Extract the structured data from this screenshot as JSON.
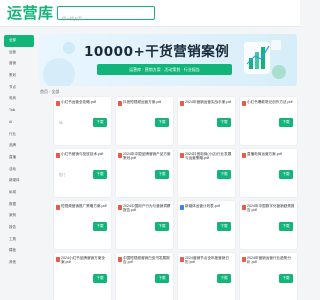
{
  "header": {
    "logo": "运营库",
    "search_placeholder": "搜一搜方案"
  },
  "sidebar": {
    "items": [
      {
        "label": "全部"
      },
      {
        "label": "运营"
      },
      {
        "label": "营销"
      },
      {
        "label": "策划"
      },
      {
        "label": "节点"
      },
      {
        "label": "电商"
      },
      {
        "label": "Talk"
      },
      {
        "label": "AI"
      },
      {
        "label": "行业"
      },
      {
        "label": "品牌"
      },
      {
        "label": "直播"
      },
      {
        "label": "活动"
      },
      {
        "label": "新媒体"
      },
      {
        "label": "私域"
      },
      {
        "label": "数据"
      },
      {
        "label": "案例"
      },
      {
        "label": "报告"
      },
      {
        "label": "工具"
      },
      {
        "label": "模板"
      },
      {
        "label": "其他"
      }
    ]
  },
  "banner": {
    "title": "10000+干货营销案例",
    "subtitle": "运营库 · 营销方案 · 活动策划 · 行业报告"
  },
  "breadcrumb": {
    "home": "首页",
    "current": "全部"
  },
  "card_button_label": "下载",
  "cards": [
    {
      "title": "小红书运营全攻略.pdf",
      "meta": "98",
      "icon": "pdf"
    },
    {
      "title": "抖音短视频运营方案.pdf",
      "meta": "",
      "icon": "pdf"
    },
    {
      "title": "2024年营销运营实战手册.pdf",
      "meta": "",
      "icon": "pdf"
    },
    {
      "title": "小红书爆款笔记创作方法.pdf",
      "meta": "",
      "icon": "pdf"
    },
    {
      "title": "小红书营销与投放技术.pdf",
      "meta": "热门",
      "icon": "pdf"
    },
    {
      "title": "2024年中国品牌营销产品方案策划.pdf",
      "meta": "",
      "icon": "pdf"
    },
    {
      "title": "2024抖音电商(小店)行业发展与运营策略.pdf",
      "meta": "",
      "icon": "pdf"
    },
    {
      "title": "直播电商运营方案.pdf",
      "meta": "",
      "icon": "pdf"
    },
    {
      "title": "短视频营销推广策略方案.pdf",
      "meta": "",
      "icon": "pdf"
    },
    {
      "title": "2024中国用户行为与营销洞察报告.pdf",
      "meta": "",
      "icon": "pdf"
    },
    {
      "title": "新媒体运营计划表.pdf",
      "meta": "",
      "icon": "doc"
    },
    {
      "title": "2024年中国数字化营销趋势报告.pdf",
      "meta": "",
      "icon": "pdf"
    },
    {
      "title": "2024小红书品牌营销方案全案.pdf",
      "meta": "",
      "icon": "pdf"
    },
    {
      "title": "中国短视频营销白皮书发展报告.pdf",
      "meta": "",
      "icon": "pdf"
    },
    {
      "title": "2024营销节点全年度营销日历.pdf",
      "meta": "",
      "icon": "pdf"
    },
    {
      "title": "2024年营销运营行业趋势分析.pdf",
      "meta": "",
      "icon": "pdf"
    }
  ]
}
